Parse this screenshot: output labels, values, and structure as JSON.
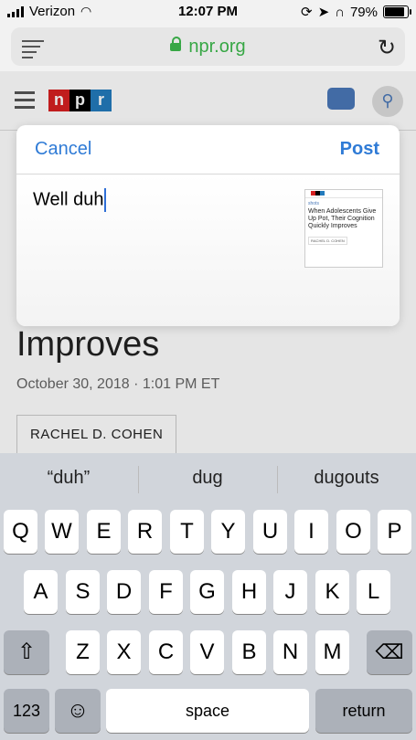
{
  "status": {
    "carrier": "Verizon",
    "time": "12:07 PM",
    "battery": "79%"
  },
  "browser": {
    "url": "npr.org"
  },
  "page": {
    "logo_letters": [
      "n",
      "p",
      "r"
    ],
    "headline": "Improves",
    "dateline": "October 30, 2018 · 1:01 PM ET",
    "author": "RACHEL D. COHEN"
  },
  "share": {
    "cancel_label": "Cancel",
    "post_label": "Post",
    "text": "Well duh",
    "preview": {
      "section": "shots",
      "title": "When Adolescents Give Up Pot, Their Cognition Quickly Improves",
      "author": "RACHEL D. COHEN"
    }
  },
  "keyboard": {
    "suggestions": [
      "“duh”",
      "dug",
      "dugouts"
    ],
    "row1": [
      "Q",
      "W",
      "E",
      "R",
      "T",
      "Y",
      "U",
      "I",
      "O",
      "P"
    ],
    "row2": [
      "A",
      "S",
      "D",
      "F",
      "G",
      "H",
      "J",
      "K",
      "L"
    ],
    "row3": [
      "Z",
      "X",
      "C",
      "V",
      "B",
      "N",
      "M"
    ],
    "numbers_label": "123",
    "space_label": "space",
    "return_label": "return"
  }
}
